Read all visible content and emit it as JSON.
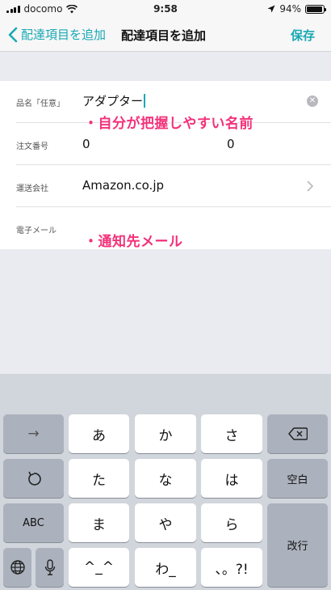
{
  "status_bar": {
    "carrier": "docomo",
    "time": "9:58",
    "battery": "94%",
    "battery_level": 0.94
  },
  "nav": {
    "back_label": "配達項目を追加",
    "title": "配達項目を追加",
    "save_label": "保存"
  },
  "form": {
    "item_name_label": "品名「任意」",
    "item_name_value": "アダプター",
    "order_no_label": "注文番号",
    "order_no_value_1": "0",
    "order_no_value_2": "0",
    "carrier_label": "運送会社",
    "carrier_value": "Amazon.co.jp",
    "email_label": "電子メール",
    "email_value": ""
  },
  "annotations": {
    "name_hint": "・自分が把握しやすい名前",
    "email_hint": "・通知先メール"
  },
  "keyboard": {
    "row1": [
      "→",
      "あ",
      "か",
      "さ"
    ],
    "row2": [
      "た",
      "な",
      "は",
      "空白"
    ],
    "row3": [
      "ABC",
      "ま",
      "や",
      "ら",
      "改行"
    ],
    "row4": [
      "^_^",
      "わ_",
      "、。?!"
    ],
    "icons": [
      "delete-icon",
      "undo-icon",
      "globe-icon",
      "microphone-icon"
    ]
  },
  "colors": {
    "accent": "#1aa9b5",
    "annotation": "#f3317a"
  }
}
